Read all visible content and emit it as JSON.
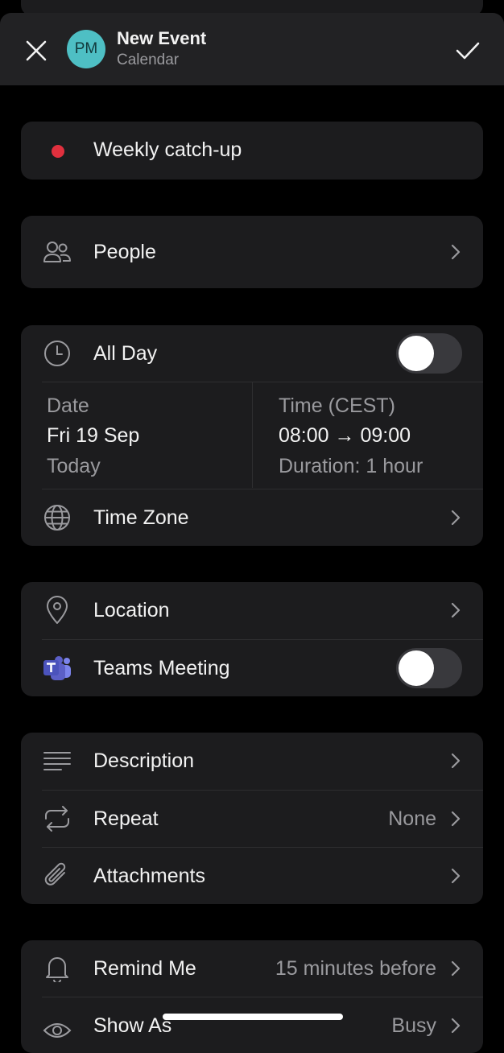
{
  "header": {
    "title": "New Event",
    "subtitle": "Calendar",
    "avatar_initials": "PM",
    "close_icon": "close-icon",
    "confirm_icon": "check-icon"
  },
  "event": {
    "title": "Weekly catch-up",
    "color": "#e0303e"
  },
  "people": {
    "label": "People"
  },
  "schedule": {
    "all_day_label": "All Day",
    "all_day_on": false,
    "date_label": "Date",
    "date_value": "Fri 19 Sep",
    "date_sub": "Today",
    "time_label": "Time (CEST)",
    "time_value": "08:00 → 09:00",
    "duration": "Duration: 1 hour",
    "timezone_label": "Time Zone"
  },
  "location": {
    "label": "Location"
  },
  "teams": {
    "label": "Teams Meeting",
    "on": false
  },
  "details": {
    "description_label": "Description",
    "repeat_label": "Repeat",
    "repeat_value": "None",
    "attachments_label": "Attachments"
  },
  "reminders": {
    "remind_label": "Remind Me",
    "remind_value": "15 minutes before",
    "show_as_label": "Show As",
    "show_as_value": "Busy"
  },
  "colors": {
    "background": "#000000",
    "card": "#1c1c1e",
    "avatar": "#4ebfc4",
    "teams": "#5b5fc7"
  }
}
